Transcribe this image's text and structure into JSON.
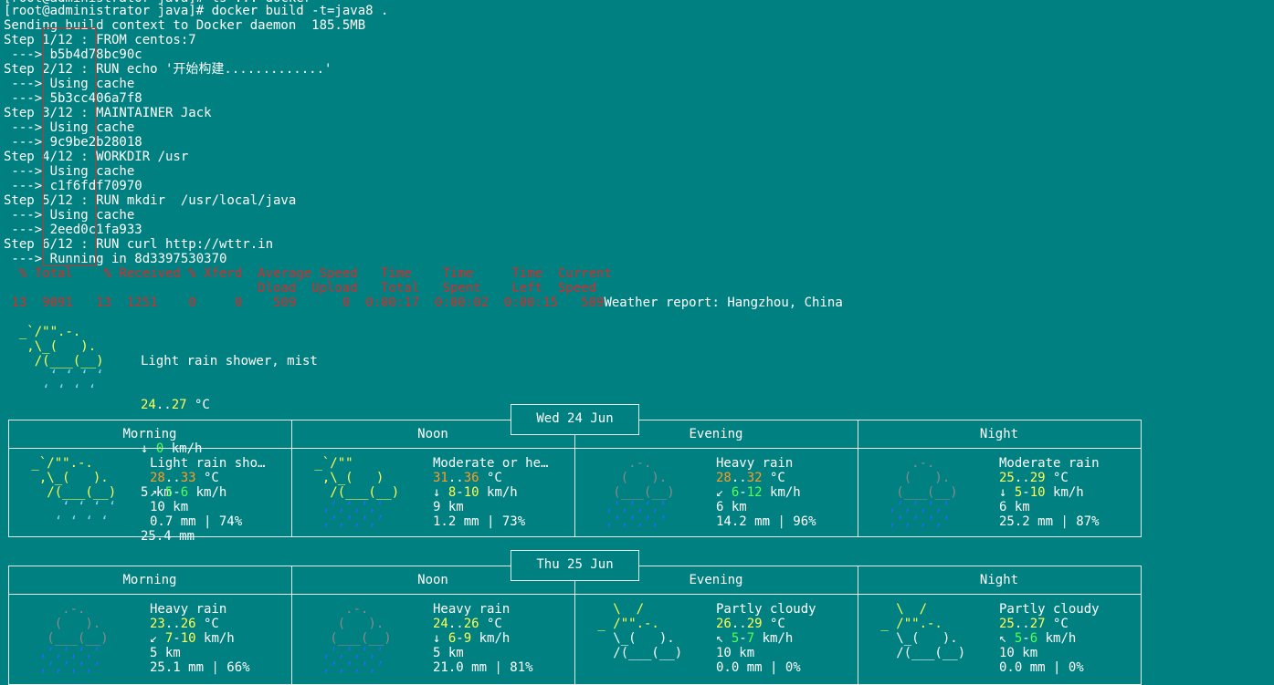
{
  "terminal": {
    "cmd_line": "[root@administrator java]# docker build -t=java8 .",
    "lines": [
      "Sending build context to Docker daemon  185.5MB",
      "Step 1/12 : FROM centos:7",
      " ---> b5b4d78bc90c",
      "Step 2/12 : RUN echo '开始构建.............'",
      " ---> Using cache",
      " ---> 5b3cc406a7f8",
      "Step 3/12 : MAINTAINER Jack",
      " ---> Using cache",
      " ---> 9c9be2b28018",
      "Step 4/12 : WORKDIR /usr",
      " ---> Using cache",
      " ---> c1f6fdf70970",
      "Step 5/12 : RUN mkdir  /usr/local/java",
      " ---> Using cache",
      " ---> 2eed0c1fa933",
      "Step 6/12 : RUN curl http://wttr.in",
      " ---> Running in 8d3397530370"
    ],
    "curl_header_1": "  % Total    % Received % Xferd  Average Speed   Time    Time     Time  Current",
    "curl_header_2": "                                 Dload  Upload   Total   Spent    Left  Speed",
    "curl_progress": " 13  9091   13  1251    0     0    509      0  0:00:17  0:00:02  0:00:15   509",
    "weather_report": "Weather report: Hangzhou, China"
  },
  "current": {
    "art": [
      "  _`/\"\".-.    ",
      "   ,\\_(   ).  ",
      "    /(___(__) ",
      "      ‘ ‘ ‘ ‘ ",
      "     ‘ ‘ ‘ ‘  "
    ],
    "condition": "Light rain shower, mist",
    "temp_low": "24",
    "temp_high": "27",
    "temp_unit": " °C",
    "wind_arrow": "↓ ",
    "wind": "0",
    "wind_unit": " km/h",
    "visibility": "5 km",
    "precip": "25.4 mm"
  },
  "days": [
    {
      "date": "Wed 24 Jun",
      "periods": [
        {
          "name": "Morning",
          "art": [
            " _`/\"\".-.    ",
            "  ,\\_(   ).  ",
            "   /(___(__) ",
            "     ‘ ‘ ‘ ‘ ",
            "    ‘ ‘ ‘ ‘  "
          ],
          "art_color": "sun",
          "condition": "Light rain sho…",
          "t1": "28",
          "t2": "33",
          "tcolor": "orn",
          "dir": "↗ ",
          "w1": "5",
          "w2": "6",
          "wcolor": "grn",
          "vis": "10 km",
          "precip": "0.7 mm | 74%"
        },
        {
          "name": "Noon",
          "art": [
            " _`/\"\"      ",
            "  ,\\_(   )  ",
            "   /(___(__) ",
            "  ‚‘‚‘‚‘‚‘  ",
            "  ‚’‚’‚’‚’  "
          ],
          "art_color": "sunheavy",
          "condition": "Moderate or he…",
          "t1": "31",
          "t2": "36",
          "tcolor": "orn",
          "dir": "↓ ",
          "w1": "8",
          "w2": "10",
          "wcolor": "yel",
          "vis": "9 km",
          "precip": "1.2 mm | 73%"
        },
        {
          "name": "Evening",
          "art": [
            "     .-.     ",
            "    (   ).   ",
            "   (___(__)  ",
            "  ‚‘‚‘‚‘‚‘   ",
            "  ‚’‚’‚’‚’   "
          ],
          "art_color": "heavy",
          "condition": "Heavy rain",
          "t1": "28",
          "t2": "32",
          "tcolor": "orn",
          "dir": "↙ ",
          "w1": "6",
          "w2": "12",
          "wcolor": "grn",
          "vis": "6 km",
          "precip": "14.2 mm | 96%"
        },
        {
          "name": "Night",
          "art": [
            "     .-.     ",
            "    (   ).   ",
            "   (___(__)  ",
            "  ‚‘‚‘‚‘‚‘   ",
            "  ‚’‚’‚’‚’   "
          ],
          "art_color": "heavy",
          "condition": "Moderate rain",
          "t1": "25",
          "t2": "29",
          "tcolor": "yel",
          "dir": "↓ ",
          "w1": "5",
          "w2": "10",
          "wcolor": "yel",
          "vis": "6 km",
          "precip": "25.2 mm | 87%"
        }
      ]
    },
    {
      "date": "Thu 25 Jun",
      "periods": [
        {
          "name": "Morning",
          "art": [
            "     .-.     ",
            "    (   ).   ",
            "   (___(__)  ",
            "  ‚‘‚‘‚‘‚‘   ",
            "  ‚’‚’‚’‚’   "
          ],
          "art_color": "heavy",
          "condition": "Heavy rain",
          "t1": "23",
          "t2": "26",
          "tcolor": "yel",
          "dir": "↙ ",
          "w1": "7",
          "w2": "10",
          "wcolor": "yel",
          "vis": "5 km",
          "precip": "25.1 mm | 66%"
        },
        {
          "name": "Noon",
          "art": [
            "     .-.     ",
            "    (   ).   ",
            "   (___(__)  ",
            "  ‚‘‚‘‚‘‚‘   ",
            "  ‚’‚’‚’‚’   "
          ],
          "art_color": "heavy",
          "condition": "Heavy rain",
          "t1": "24",
          "t2": "26",
          "tcolor": "yel",
          "dir": "↓ ",
          "w1": "6",
          "w2": "9",
          "wcolor": "yel",
          "vis": "5 km",
          "precip": "21.0 mm | 81%"
        },
        {
          "name": "Evening",
          "art": [
            "   \\  /      ",
            " _ /\"\".-.    ",
            "   \\_(   ).  ",
            "   /(___(__) ",
            "             "
          ],
          "art_color": "partly",
          "condition": "Partly cloudy",
          "t1": "26",
          "t2": "29",
          "tcolor": "yel",
          "dir": "↖ ",
          "w1": "5",
          "w2": "7",
          "wcolor": "grn",
          "vis": "10 km",
          "precip": "0.0 mm | 0%"
        },
        {
          "name": "Night",
          "art": [
            "   \\  /      ",
            " _ /\"\".-.    ",
            "   \\_(   ).  ",
            "   /(___(__) ",
            "             "
          ],
          "art_color": "partly",
          "condition": "Partly cloudy",
          "t1": "25",
          "t2": "27",
          "tcolor": "yel",
          "dir": "↖ ",
          "w1": "5",
          "w2": "6",
          "wcolor": "grn",
          "vis": "10 km",
          "precip": "0.0 mm | 0%"
        }
      ]
    }
  ],
  "colors": {
    "background": "#008080",
    "highlight_box": "#d42c2c",
    "curl_text": "#d42c2c"
  }
}
